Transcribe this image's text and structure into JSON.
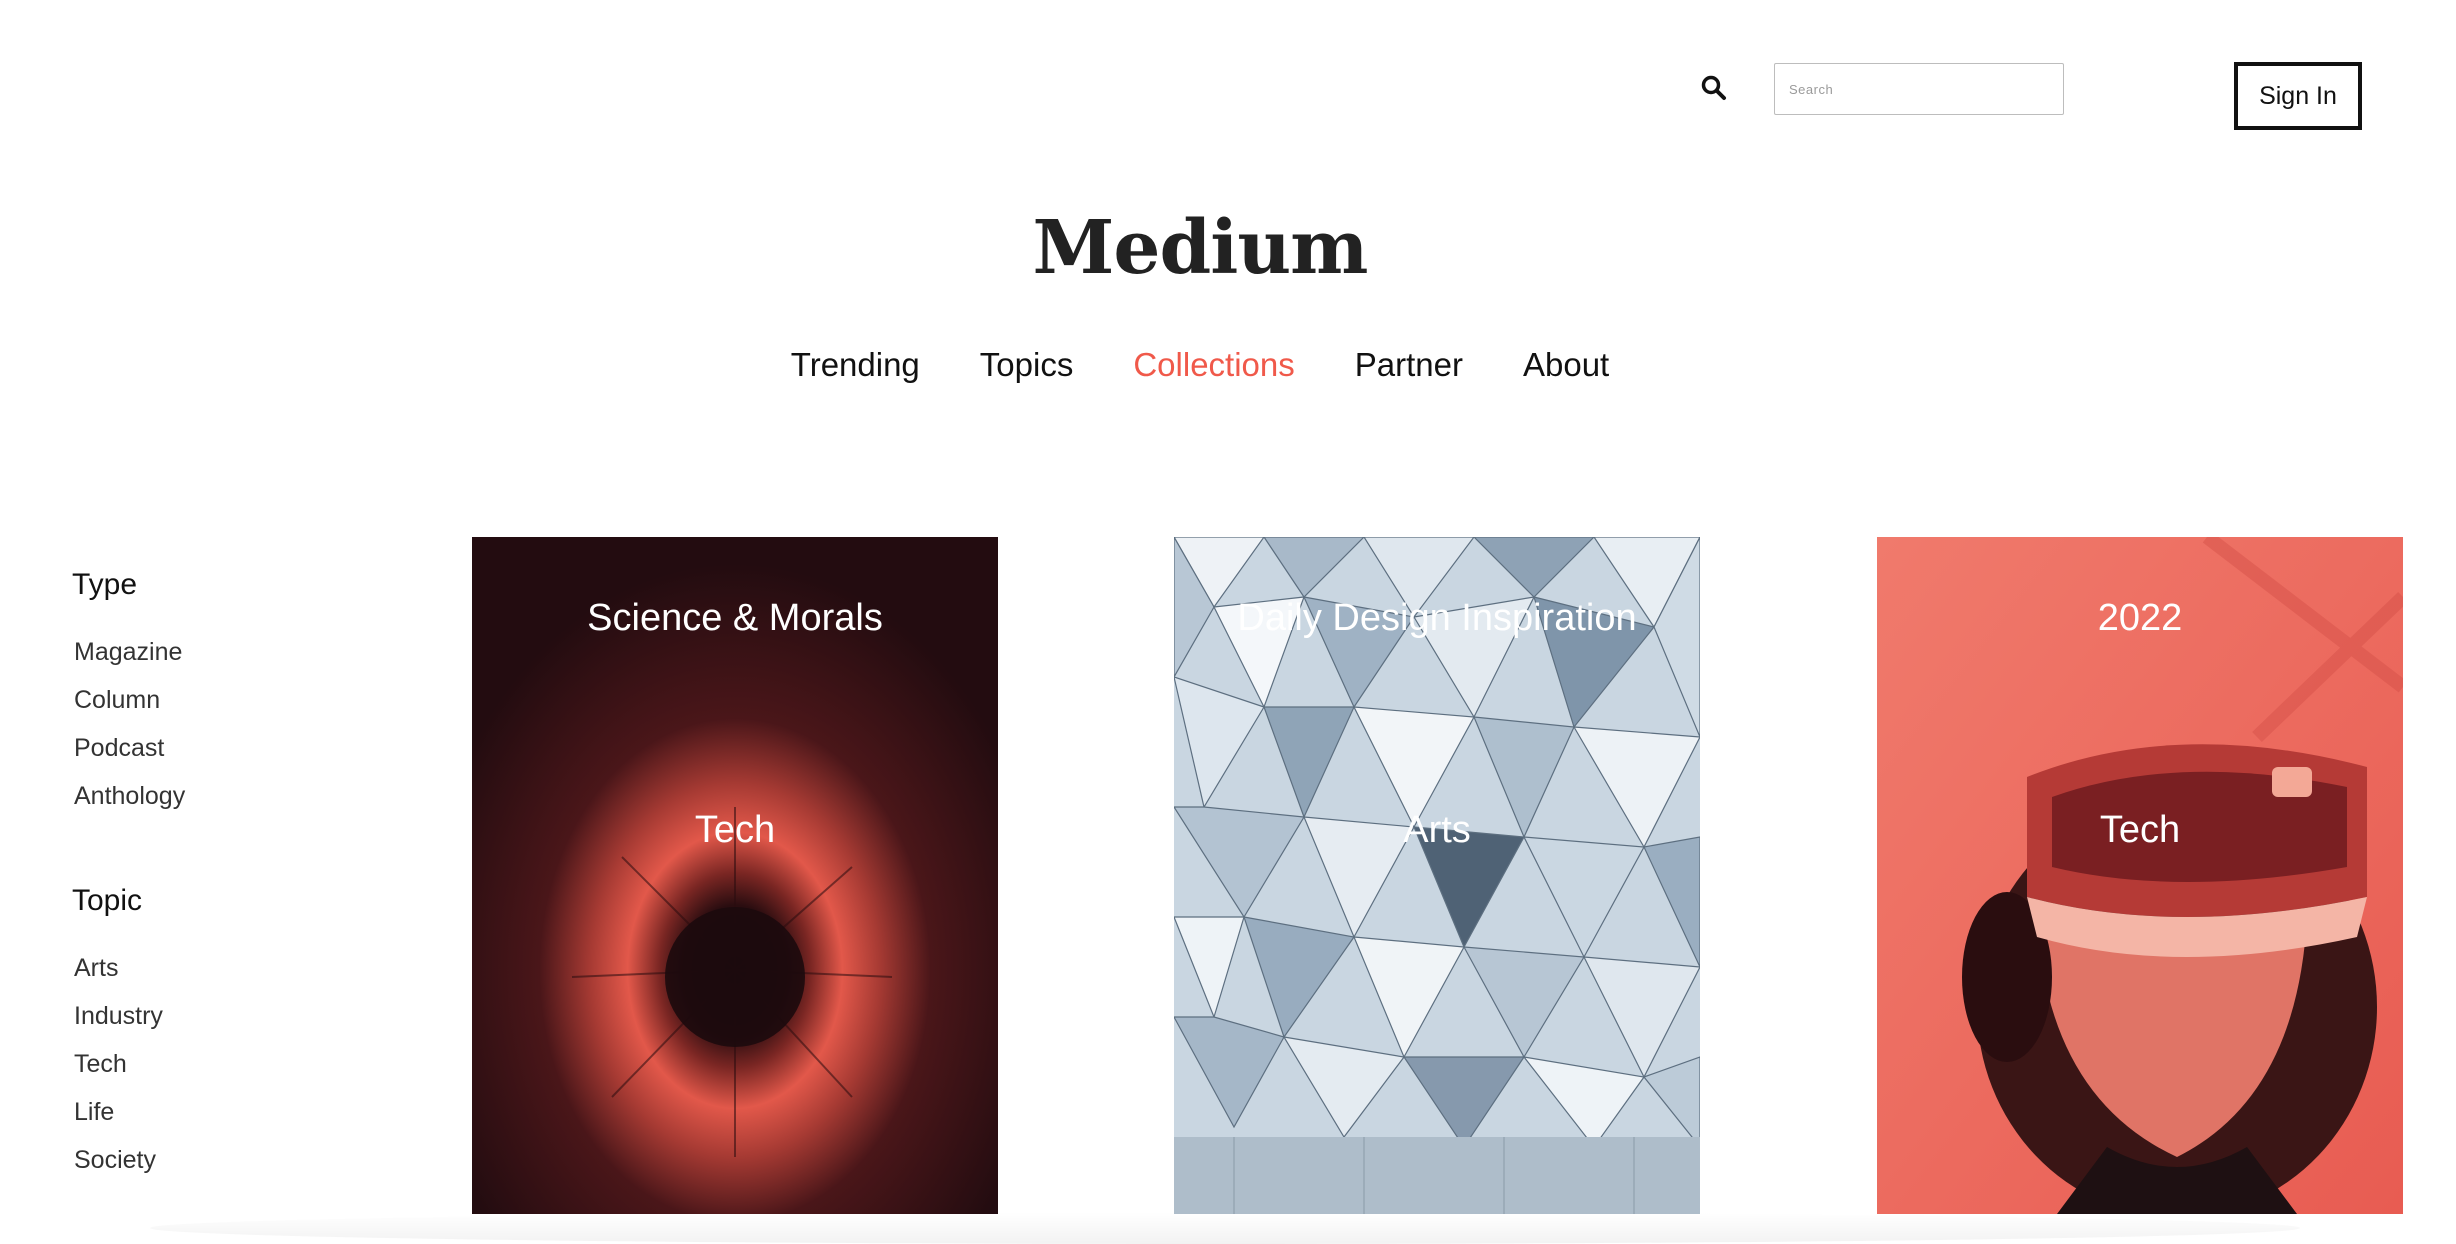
{
  "header": {
    "search": {
      "placeholder": "Search",
      "icon": "search-icon"
    },
    "signin_label": "Sign In"
  },
  "logo": "Medium",
  "nav": {
    "items": [
      "Trending",
      "Topics",
      "Collections",
      "Partner",
      "About"
    ],
    "active": "Collections",
    "active_color": "#f0594a"
  },
  "sidebar": {
    "type_heading": "Type",
    "type_items": [
      "Magazine",
      "Column",
      "Podcast",
      "Anthology"
    ],
    "topic_heading": "Topic",
    "topic_items": [
      "Arts",
      "Industry",
      "Tech",
      "Life",
      "Society"
    ]
  },
  "cards": [
    {
      "title": "Science & Morals",
      "tag": "Tech",
      "image": "red-burst-image"
    },
    {
      "title": "Daily Design Inspiration",
      "tag": "Arts",
      "image": "geometric-facade-image"
    },
    {
      "title": "2022",
      "tag": "Tech",
      "image": "vr-headset-image"
    }
  ]
}
